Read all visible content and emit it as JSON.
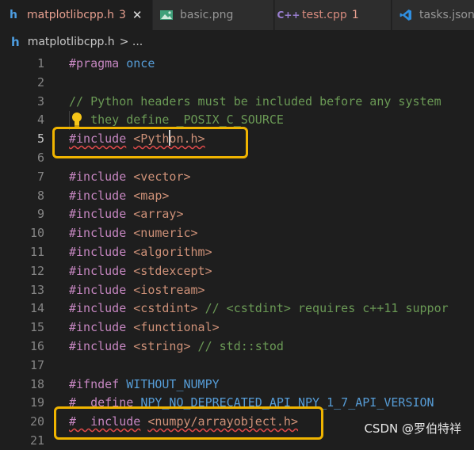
{
  "tabs": [
    {
      "icon": "h",
      "label": "matplotlibcpp.h",
      "badge": "3",
      "close": "✕"
    },
    {
      "icon": "image",
      "label": "basic.png"
    },
    {
      "icon": "C++",
      "label": "test.cpp",
      "badge": "1"
    },
    {
      "icon": "vscode",
      "label": "tasks.json"
    }
  ],
  "breadcrumb": {
    "icon": "h",
    "file": "matplotlibcpp.h",
    "rest": "> ..."
  },
  "lines": [
    {
      "n": "1",
      "parts": [
        {
          "c": "kw",
          "t": "#pragma"
        },
        {
          "c": "",
          "t": " "
        },
        {
          "c": "mac",
          "t": "once"
        }
      ]
    },
    {
      "n": "2",
      "parts": []
    },
    {
      "n": "3",
      "parts": [
        {
          "c": "cm",
          "t": "// Python headers must be included before any system"
        }
      ]
    },
    {
      "n": "4",
      "parts": [
        {
          "c": "cm",
          "t": "   they define _POSIX_C_SOURCE"
        }
      ]
    },
    {
      "n": "5",
      "parts": [
        {
          "c": "kw squig",
          "t": "#include"
        },
        {
          "c": "",
          "t": " "
        },
        {
          "c": "hdr squig",
          "t": "<Python.h>"
        }
      ]
    },
    {
      "n": "6",
      "parts": []
    },
    {
      "n": "7",
      "parts": [
        {
          "c": "kw",
          "t": "#include"
        },
        {
          "c": "",
          "t": " "
        },
        {
          "c": "hdr",
          "t": "<vector>"
        }
      ]
    },
    {
      "n": "8",
      "parts": [
        {
          "c": "kw",
          "t": "#include"
        },
        {
          "c": "",
          "t": " "
        },
        {
          "c": "hdr",
          "t": "<map>"
        }
      ]
    },
    {
      "n": "9",
      "parts": [
        {
          "c": "kw",
          "t": "#include"
        },
        {
          "c": "",
          "t": " "
        },
        {
          "c": "hdr",
          "t": "<array>"
        }
      ]
    },
    {
      "n": "10",
      "parts": [
        {
          "c": "kw",
          "t": "#include"
        },
        {
          "c": "",
          "t": " "
        },
        {
          "c": "hdr",
          "t": "<numeric>"
        }
      ]
    },
    {
      "n": "11",
      "parts": [
        {
          "c": "kw",
          "t": "#include"
        },
        {
          "c": "",
          "t": " "
        },
        {
          "c": "hdr",
          "t": "<algorithm>"
        }
      ]
    },
    {
      "n": "12",
      "parts": [
        {
          "c": "kw",
          "t": "#include"
        },
        {
          "c": "",
          "t": " "
        },
        {
          "c": "hdr",
          "t": "<stdexcept>"
        }
      ]
    },
    {
      "n": "13",
      "parts": [
        {
          "c": "kw",
          "t": "#include"
        },
        {
          "c": "",
          "t": " "
        },
        {
          "c": "hdr",
          "t": "<iostream>"
        }
      ]
    },
    {
      "n": "14",
      "parts": [
        {
          "c": "kw",
          "t": "#include"
        },
        {
          "c": "",
          "t": " "
        },
        {
          "c": "hdr",
          "t": "<cstdint>"
        },
        {
          "c": "cm",
          "t": " // <cstdint> requires c++11 suppor"
        }
      ]
    },
    {
      "n": "15",
      "parts": [
        {
          "c": "kw",
          "t": "#include"
        },
        {
          "c": "",
          "t": " "
        },
        {
          "c": "hdr",
          "t": "<functional>"
        }
      ]
    },
    {
      "n": "16",
      "parts": [
        {
          "c": "kw",
          "t": "#include"
        },
        {
          "c": "",
          "t": " "
        },
        {
          "c": "hdr",
          "t": "<string>"
        },
        {
          "c": "cm",
          "t": " // std::stod"
        }
      ]
    },
    {
      "n": "17",
      "parts": []
    },
    {
      "n": "18",
      "parts": [
        {
          "c": "kw",
          "t": "#ifndef"
        },
        {
          "c": "",
          "t": " "
        },
        {
          "c": "mac",
          "t": "WITHOUT_NUMPY"
        }
      ]
    },
    {
      "n": "19",
      "parts": [
        {
          "c": "kw",
          "t": "#  define"
        },
        {
          "c": "",
          "t": " "
        },
        {
          "c": "mac",
          "t": "NPY_NO_DEPRECATED_API NPY_1_7_API_VERSION"
        }
      ]
    },
    {
      "n": "20",
      "parts": [
        {
          "c": "kw squig",
          "t": "#  include"
        },
        {
          "c": "",
          "t": " "
        },
        {
          "c": "hdr squig",
          "t": "<numpy/arrayobject.h>"
        }
      ]
    },
    {
      "n": "21",
      "parts": []
    }
  ],
  "current_line": "5",
  "watermark": "CSDN @罗伯特祥",
  "colors": {
    "keyword": "#c586c0",
    "macro": "#569cd6",
    "string": "#ce9178",
    "comment": "#6a9955",
    "highlight_box": "#f0b400"
  }
}
